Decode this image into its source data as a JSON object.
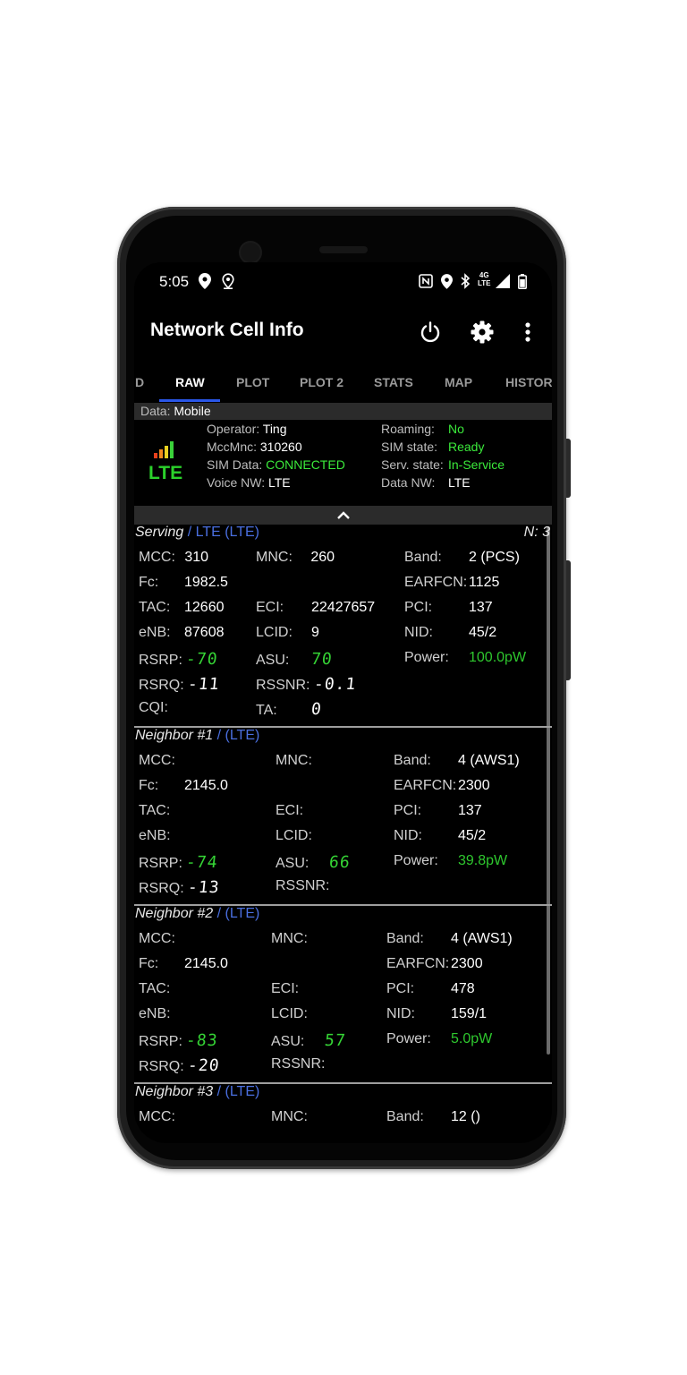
{
  "status_bar": {
    "time": "5:05",
    "icons_left": [
      "location-pin-icon",
      "location-outline-icon"
    ],
    "icons_right": [
      "nfc-icon",
      "location-pin-icon",
      "bluetooth-icon",
      "4g-lte-icon",
      "signal-icon",
      "battery-icon"
    ],
    "network_label_top": "4G",
    "network_label_bottom": "LTE"
  },
  "app_bar": {
    "title": "Network Cell Info",
    "actions": [
      "power-icon",
      "gear-icon",
      "more-vert-icon"
    ]
  },
  "tabs": [
    {
      "label": "D",
      "active": false
    },
    {
      "label": "RAW",
      "active": true
    },
    {
      "label": "PLOT",
      "active": false
    },
    {
      "label": "PLOT 2",
      "active": false
    },
    {
      "label": "STATS",
      "active": false
    },
    {
      "label": "MAP",
      "active": false
    },
    {
      "label": "HISTOR",
      "active": false
    }
  ],
  "data_strip": {
    "label": "Data:",
    "value": "Mobile"
  },
  "summary": {
    "tech": "LTE",
    "rows_left": [
      {
        "label": "Operator:",
        "value": "Ting"
      },
      {
        "label": "MccMnc:",
        "value": "310260"
      },
      {
        "label": "SIM Data:",
        "value": "CONNECTED"
      },
      {
        "label": "Voice NW:",
        "value": "LTE"
      }
    ],
    "rows_right": [
      {
        "label": "Roaming:",
        "value": "No"
      },
      {
        "label": "SIM state:",
        "value": "Ready"
      },
      {
        "label": "Serv. state:",
        "value": "In-Service"
      },
      {
        "label": "Data NW:",
        "value": "LTE"
      }
    ]
  },
  "serving": {
    "title": "Serving",
    "tech": "/ LTE (LTE)",
    "n_count": "N: 3",
    "mcc_label": "MCC:",
    "mcc": "310",
    "mnc_label": "MNC:",
    "mnc": "260",
    "band_label": "Band:",
    "band": "2 (PCS)",
    "fc_label": "Fc:",
    "fc": "1982.5",
    "earfcn_label": "EARFCN:",
    "earfcn": "1125",
    "tac_label": "TAC:",
    "tac": "12660",
    "eci_label": "ECI:",
    "eci": "22427657",
    "pci_label": "PCI:",
    "pci": "137",
    "enb_label": "eNB:",
    "enb": "87608",
    "lcid_label": "LCID:",
    "lcid": "9",
    "nid_label": "NID:",
    "nid": "45/2",
    "rsrp_label": "RSRP:",
    "rsrp": "-70",
    "asu_label": "ASU:",
    "asu": "70",
    "power_label": "Power:",
    "power": "100.0pW",
    "rsrq_label": "RSRQ:",
    "rsrq": "-11",
    "rssnr_label": "RSSNR:",
    "rssnr": "-0.1",
    "cqi_label": "CQI:",
    "ta_label": "TA:",
    "ta": "0"
  },
  "neighbor1": {
    "title": "Neighbor #1",
    "tech": "/ (LTE)",
    "mcc_label": "MCC:",
    "mnc_label": "MNC:",
    "band_label": "Band:",
    "band": "4 (AWS1)",
    "fc_label": "Fc:",
    "fc": "2145.0",
    "earfcn_label": "EARFCN:",
    "earfcn": "2300",
    "tac_label": "TAC:",
    "eci_label": "ECI:",
    "pci_label": "PCI:",
    "pci": "137",
    "enb_label": "eNB:",
    "lcid_label": "LCID:",
    "nid_label": "NID:",
    "nid": "45/2",
    "rsrp_label": "RSRP:",
    "rsrp": "-74",
    "asu_label": "ASU:",
    "asu": "66",
    "power_label": "Power:",
    "power": "39.8pW",
    "rsrq_label": "RSRQ:",
    "rsrq": "-13",
    "rssnr_label": "RSSNR:"
  },
  "neighbor2": {
    "title": "Neighbor #2",
    "tech": "/ (LTE)",
    "mcc_label": "MCC:",
    "mnc_label": "MNC:",
    "band_label": "Band:",
    "band": "4 (AWS1)",
    "fc_label": "Fc:",
    "fc": "2145.0",
    "earfcn_label": "EARFCN:",
    "earfcn": "2300",
    "tac_label": "TAC:",
    "eci_label": "ECI:",
    "pci_label": "PCI:",
    "pci": "478",
    "enb_label": "eNB:",
    "lcid_label": "LCID:",
    "nid_label": "NID:",
    "nid": "159/1",
    "rsrp_label": "RSRP:",
    "rsrp": "-83",
    "asu_label": "ASU:",
    "asu": "57",
    "power_label": "Power:",
    "power": "5.0pW",
    "rsrq_label": "RSRQ:",
    "rsrq": "-20",
    "rssnr_label": "RSSNR:"
  },
  "neighbor3": {
    "title": "Neighbor #3",
    "tech": "/ (LTE)",
    "mcc_label": "MCC:",
    "mnc_label": "MNC:",
    "band_label": "Band:",
    "band": "12 ()"
  },
  "colors": {
    "accent_blue": "#2a57e8",
    "tech_blue": "#4a6fe0",
    "green": "#2ec72e",
    "lte_green": "#2bd12b",
    "background": "#000000"
  }
}
